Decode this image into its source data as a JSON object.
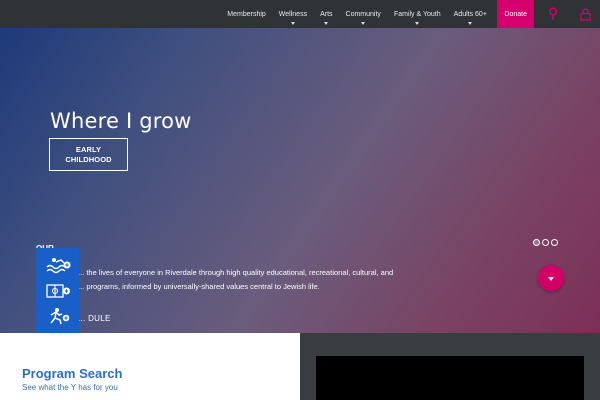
{
  "nav": {
    "items": [
      {
        "label": "Membership",
        "has_dropdown": false
      },
      {
        "label": "Wellness",
        "has_dropdown": true
      },
      {
        "label": "Arts",
        "has_dropdown": true
      },
      {
        "label": "Community",
        "has_dropdown": true
      },
      {
        "label": "Family & Youth",
        "has_dropdown": true
      },
      {
        "label": "Adults 60+",
        "has_dropdown": true
      }
    ],
    "donate_label": "Donate",
    "icons": [
      "location-pin-icon",
      "lock-icon"
    ],
    "accent_color": "#d5006d"
  },
  "hero": {
    "title": "Where I grow",
    "button_line1": "EARLY",
    "button_line2": "CHILDHOOD",
    "about_title": "OUR",
    "about_line1": "... the lives of everyone in Riverdale through high quality educational, recreational, cultural, and",
    "about_line2": "... programs, informed by universally-shared values central to Jewish life.",
    "schedule_link": "... DULE",
    "slides": {
      "count": 3,
      "active": 1
    },
    "side_tab_icons": [
      "swimmer-icon",
      "court-icon",
      "runner-icon"
    ]
  },
  "program_search": {
    "title": "Program Search",
    "subtitle": "See what the Y has for you"
  }
}
